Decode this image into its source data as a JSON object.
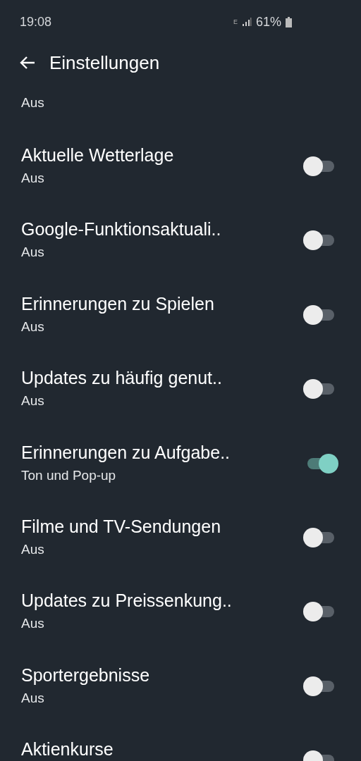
{
  "status_bar": {
    "time": "19:08",
    "network": "E",
    "battery": "61%"
  },
  "header": {
    "title": "Einstellungen"
  },
  "partial_row": {
    "subtitle": "Aus"
  },
  "settings": [
    {
      "title": "Aktuelle Wetterlage",
      "subtitle": "Aus",
      "on": false
    },
    {
      "title": "Google-Funktionsaktuali..",
      "subtitle": "Aus",
      "on": false
    },
    {
      "title": "Erinnerungen zu Spielen",
      "subtitle": "Aus",
      "on": false
    },
    {
      "title": "Updates zu häufig genut..",
      "subtitle": "Aus",
      "on": false
    },
    {
      "title": "Erinnerungen zu Aufgabe..",
      "subtitle": "Ton und Pop-up",
      "on": true
    },
    {
      "title": "Filme und TV-Sendungen",
      "subtitle": "Aus",
      "on": false
    },
    {
      "title": "Updates zu Preissenkung..",
      "subtitle": "Aus",
      "on": false
    },
    {
      "title": "Sportergebnisse",
      "subtitle": "Aus",
      "on": false
    },
    {
      "title": "Aktienkurse",
      "on": false
    }
  ]
}
